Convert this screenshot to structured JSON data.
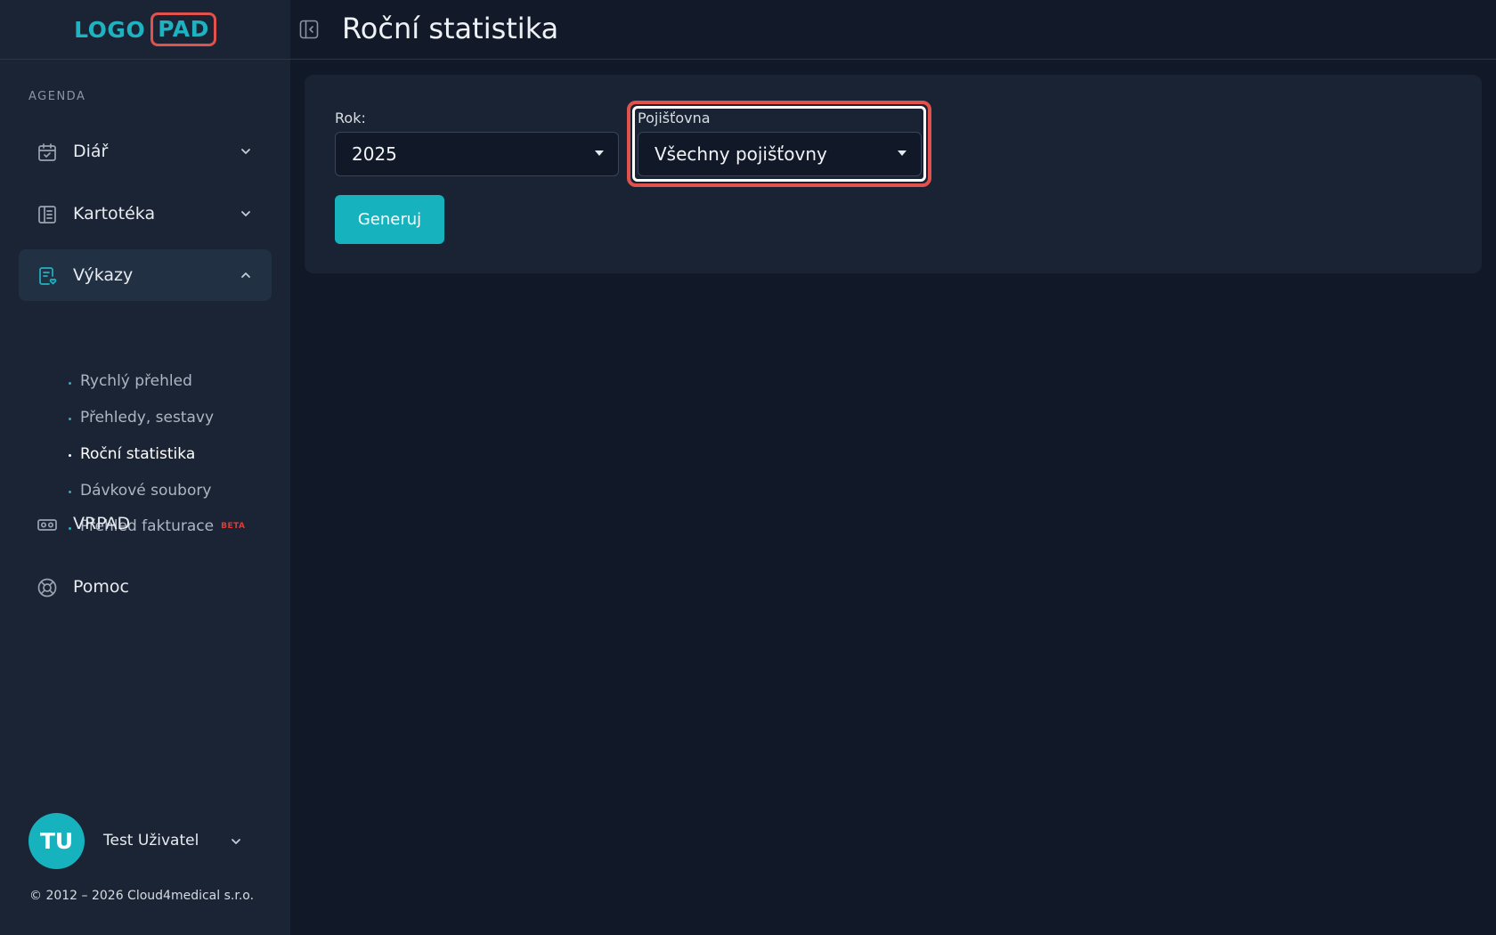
{
  "logo": {
    "main": "LOGO",
    "accent": "PAD"
  },
  "sidebar": {
    "section_label": "AGENDA",
    "items": [
      {
        "label": "Diář",
        "icon": "calendar-check-icon",
        "expanded": false
      },
      {
        "label": "Kartotéka",
        "icon": "card-file-icon",
        "expanded": false
      },
      {
        "label": "Výkazy",
        "icon": "report-heart-icon",
        "expanded": true
      },
      {
        "label": "VRPAD",
        "icon": "vr-headset-icon"
      },
      {
        "label": "Pomoc",
        "icon": "lifebuoy-icon"
      }
    ],
    "subitems": [
      {
        "label": "Rychlý přehled"
      },
      {
        "label": "Přehledy, sestavy"
      },
      {
        "label": "Roční statistika",
        "active": true
      },
      {
        "label": "Dávkové soubory"
      },
      {
        "label": "Přehled fakturace",
        "badge": "BETA"
      }
    ]
  },
  "user": {
    "initials": "TU",
    "name": "Test Uživatel"
  },
  "footer": {
    "copyright": "© 2012 – 2026 Cloud4medical s.r.o."
  },
  "header": {
    "title": "Roční statistika"
  },
  "form": {
    "year_label": "Rok:",
    "year_value": "2025",
    "insurer_label": "Pojišťovna",
    "insurer_value": "Všechny pojišťovny",
    "submit_label": "Generuj"
  },
  "colors": {
    "accent": "#16b3bf",
    "highlight": "#e0524b",
    "beta": "#e53935",
    "sidebar_bg": "#1b2434",
    "page_bg": "#111827"
  }
}
